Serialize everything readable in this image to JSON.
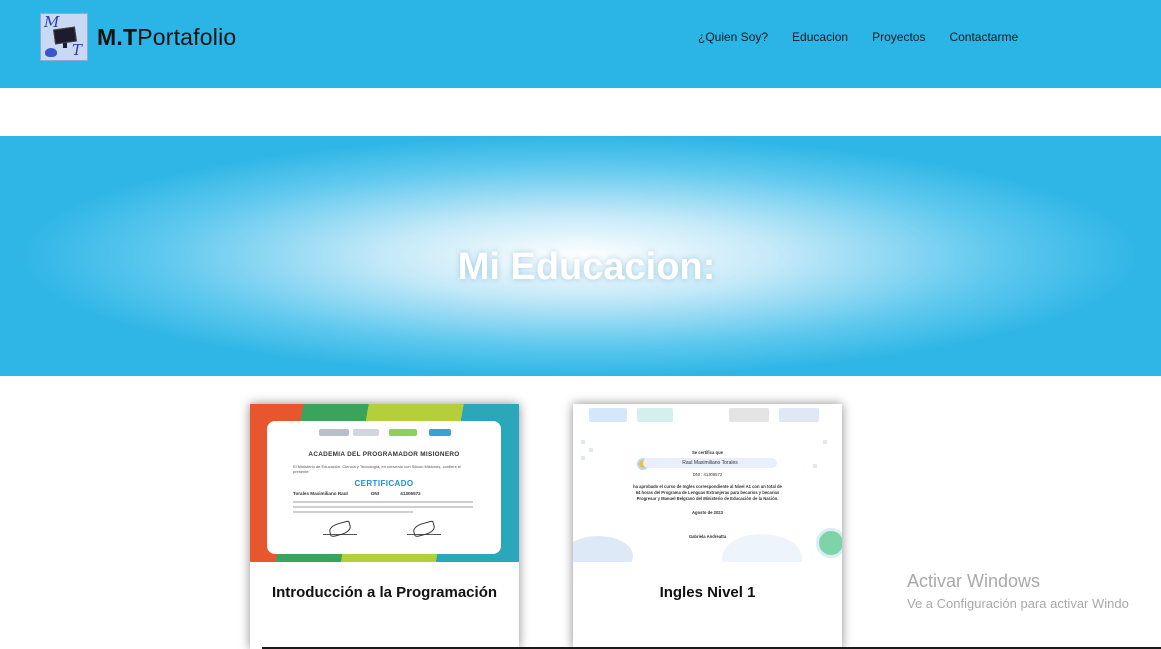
{
  "brand": {
    "logo_letter_top": "M",
    "logo_letter_bottom": "T",
    "bold": "M.T",
    "rest": "Portafolio"
  },
  "nav": {
    "items": [
      {
        "label": "¿Quien Soy?"
      },
      {
        "label": "Educacion"
      },
      {
        "label": "Proyectos"
      },
      {
        "label": "Contactarme"
      }
    ]
  },
  "hero": {
    "title": "Mi Educacion:"
  },
  "cards": [
    {
      "title": "Introducción a la Programación",
      "certificate": {
        "heading": "ACADEMIA DEL PROGRAMADOR MISIONERO",
        "intro": "El Ministerio de Educación, Ciencia y Tecnología, en convenio con Silicon Misiones, confiere el presente",
        "label": "CERTIFICADO",
        "recipient": "Torales Maximiliano Raul",
        "dni_label": "DNI",
        "dni": "41305572"
      }
    },
    {
      "title": "Ingles Nivel 1",
      "certificate": {
        "certifies": "Se certifica que",
        "recipient": "Raul Maximiliano Torales",
        "dni": "DNI : 41305572",
        "body1": "ha aprobado el curso de Ingles correspondiente al Nivel A1 con un total de",
        "body2": "64 horas del Programa de Lenguas Extranjeras para becarios y becarias",
        "body3": "Progresar y Manuel Belgrano del Ministerio de Educación de la Nación.",
        "date": "Agosto de 2023",
        "signer": "Gabriela Andreatta"
      }
    }
  ],
  "watermark": {
    "title": "Activar Windows",
    "subtitle": "Ve a Configuración para activar Windo"
  }
}
